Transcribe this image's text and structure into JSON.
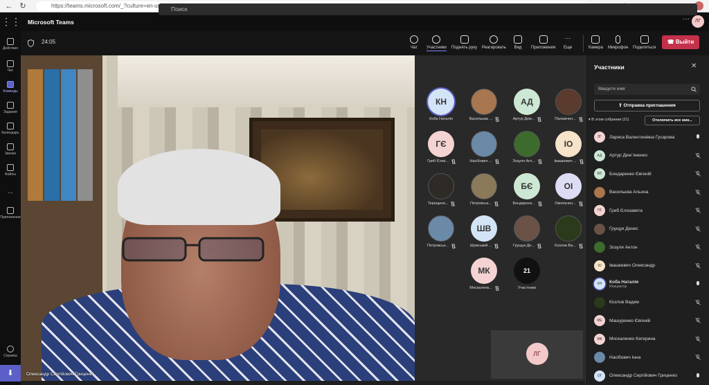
{
  "browser": {
    "url": "https://teams.microsoft.com/_?culture=en-us&country=us#/modern-calling/"
  },
  "app": {
    "name": "Microsoft Teams",
    "search_placeholder": "Поиск",
    "user_initials": "ЛГ"
  },
  "rail": {
    "items": [
      {
        "label": "Действия",
        "icon": "bell-icon"
      },
      {
        "label": "Чат",
        "icon": "chat-icon"
      },
      {
        "label": "Команды",
        "icon": "teams-icon",
        "active": true
      },
      {
        "label": "Задания",
        "icon": "assignments-icon"
      },
      {
        "label": "Календарь",
        "icon": "calendar-icon"
      },
      {
        "label": "Звонки",
        "icon": "phone-icon"
      },
      {
        "label": "Файлы",
        "icon": "files-icon"
      },
      {
        "label": "...",
        "icon": "more-icon"
      },
      {
        "label": "Приложения",
        "icon": "apps-icon"
      },
      {
        "label": "Справка",
        "icon": "help-icon"
      }
    ]
  },
  "meeting": {
    "timer": "24:05",
    "controls": [
      {
        "label": "Чат",
        "icon": "chat-icon"
      },
      {
        "label": "Участники",
        "icon": "people-icon",
        "active": true
      },
      {
        "label": "Поднять руку",
        "icon": "hand-icon"
      },
      {
        "label": "Реагировать",
        "icon": "smile-icon"
      },
      {
        "label": "Вид",
        "icon": "grid-icon"
      },
      {
        "label": "Приложения",
        "icon": "plus-icon"
      },
      {
        "label": "Еще",
        "icon": "more-icon"
      },
      {
        "label": "Камера",
        "icon": "camera-icon"
      },
      {
        "label": "Микрофон",
        "icon": "mic-icon"
      },
      {
        "label": "Поделиться",
        "icon": "share-icon"
      }
    ],
    "leave_label": "Выйти",
    "main_video_name": "Олександр Сергійович Гриценко"
  },
  "gallery": {
    "tiles": [
      {
        "name": "Коба Наталія",
        "initials": "КН",
        "color": "#d4e4f7",
        "muted": false,
        "ring": true
      },
      {
        "name": "Васильєва ...",
        "initials": "",
        "color": "#a8764f",
        "muted": true
      },
      {
        "name": "Артур Дем...",
        "initials": "АД",
        "color": "#cce8d4",
        "muted": true
      },
      {
        "name": "Палажчен...",
        "initials": "",
        "color": "#5a3b2e",
        "muted": true
      },
      {
        "name": "Гриб Єлиз...",
        "initials": "ГЄ",
        "color": "#f5d3d3",
        "muted": true
      },
      {
        "name": "Насібович ...",
        "initials": "",
        "color": "#6b8aa8",
        "muted": true
      },
      {
        "name": "Зозуля Ант...",
        "initials": "",
        "color": "#3d6b2e",
        "muted": true
      },
      {
        "name": "Івашкевич ...",
        "initials": "ІО",
        "color": "#f7e3c9",
        "muted": true
      },
      {
        "name": "Терещенк...",
        "initials": "",
        "color": "#2e2a26",
        "muted": true
      },
      {
        "name": "Петровськ...",
        "initials": "",
        "color": "#8a7a5a",
        "muted": true
      },
      {
        "name": "Бондаренк...",
        "initials": "БЄ",
        "color": "#cce8d4",
        "muted": true
      },
      {
        "name": "Омельчен...",
        "initials": "ОІ",
        "color": "#dcdcf5",
        "muted": true
      },
      {
        "name": "Петровськ...",
        "initials": "",
        "color": "#6b8aa8",
        "muted": true
      },
      {
        "name": "Шумський ...",
        "initials": "ШВ",
        "color": "#d4e4f7",
        "muted": true
      },
      {
        "name": "Грущук Де...",
        "initials": "",
        "color": "#6a5246",
        "muted": true
      },
      {
        "name": "Козлов Ва...",
        "initials": "",
        "color": "#2a3a1a",
        "muted": true
      },
      {
        "name": "Москаленк...",
        "initials": "МК",
        "color": "#f5d3d3",
        "muted": true
      },
      {
        "name": "Участники",
        "initials": "21",
        "color": "#111111",
        "muted": false
      }
    ],
    "self_initials": "ЛГ"
  },
  "panel": {
    "title": "Участники",
    "search_placeholder": "Введите имя",
    "invite_label": "Отправка приглашения",
    "section_label": "В этом собрании (21)",
    "mute_all_label": "Отключить все мик...",
    "participants": [
      {
        "name": "Лариса Валентинівна Гусарова",
        "initials": "ЛГ",
        "color": "#f5d3d3",
        "mic": "on"
      },
      {
        "name": "Артур Дем`яненко",
        "initials": "АД",
        "color": "#cce8d4",
        "mic": "off"
      },
      {
        "name": "Бондаренко Євгеній",
        "initials": "БЄ",
        "color": "#cce8d4",
        "mic": "off"
      },
      {
        "name": "Васильєва Альона",
        "initials": "",
        "color": "#a8764f",
        "mic": "off"
      },
      {
        "name": "Гриб Єлизавета",
        "initials": "ГЄ",
        "color": "#f5d3d3",
        "mic": "off"
      },
      {
        "name": "Грущук Денис",
        "initials": "",
        "color": "#6a5246",
        "mic": "off"
      },
      {
        "name": "Зозуля Антон",
        "initials": "",
        "color": "#3d6b2e",
        "mic": "off"
      },
      {
        "name": "Івашкевич Олександр",
        "initials": "ІО",
        "color": "#f7e3c9",
        "mic": "off"
      },
      {
        "name": "Коба Наталія",
        "subtitle": "Инициатор",
        "initials": "КН",
        "color": "#d4e4f7",
        "mic": "on"
      },
      {
        "name": "Козлов Вадим",
        "initials": "",
        "color": "#2a3a1a",
        "mic": "off"
      },
      {
        "name": "Машуренко Євгеній",
        "initials": "МЕ",
        "color": "#f5d3d3",
        "mic": "off"
      },
      {
        "name": "Москаленко Катерина",
        "initials": "МК",
        "color": "#f5d3d3",
        "mic": "off"
      },
      {
        "name": "Насібович Інна",
        "initials": "",
        "color": "#6b8aa8",
        "mic": "off"
      },
      {
        "name": "Олександр Сергійович Гриценко",
        "initials": "ОГ",
        "color": "#d4e4f7",
        "mic": "on"
      }
    ]
  },
  "colors": {
    "accent": "#5b5fc7",
    "leave": "#c4314b"
  }
}
